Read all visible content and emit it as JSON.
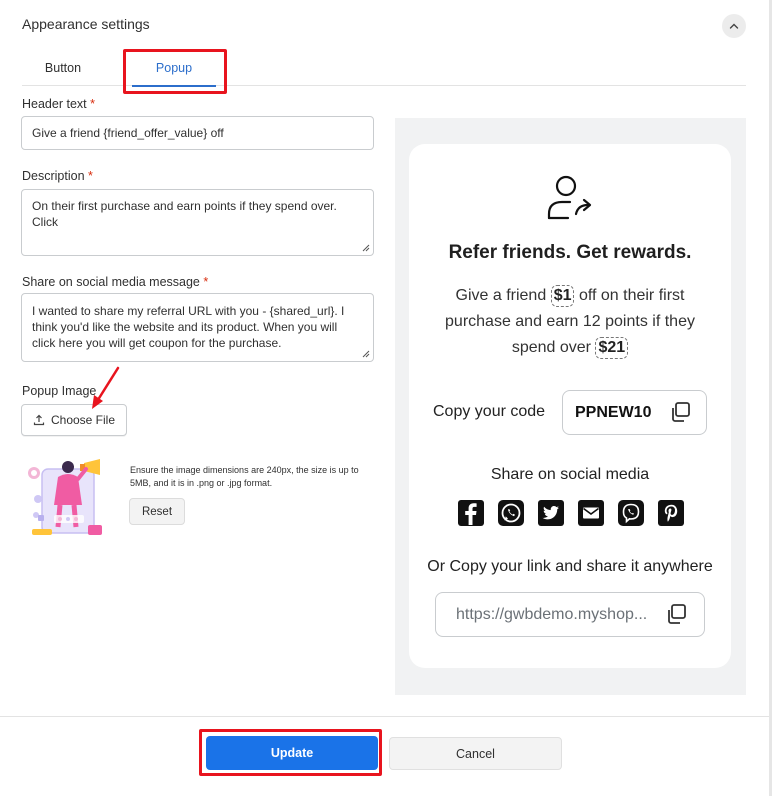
{
  "section": {
    "title": "Appearance settings"
  },
  "tabs": [
    {
      "label": "Button"
    },
    {
      "label": "Popup"
    }
  ],
  "fields": {
    "header_text": {
      "label": "Header text",
      "required": "*",
      "value": "Give a friend {friend_offer_value} off"
    },
    "description": {
      "label": "Description",
      "required": "*",
      "value": "On their first purchase and earn  points if they spend over.  Click"
    },
    "share_message": {
      "label": "Share on social media message",
      "required": "*",
      "value": "I wanted to share my referral URL with you - {shared_url}. I think you'd like the website and its product. When you will click here you will get coupon for the purchase."
    }
  },
  "popup_image": {
    "label": "Popup Image",
    "choose_label": "Choose File",
    "note": "Ensure the image dimensions are 240px, the size is up to 5MB, and it is in .png or .jpg format.",
    "reset_label": "Reset"
  },
  "preview": {
    "title": "Refer friends. Get rewards.",
    "desc_1": "Give a friend",
    "friend_value": "$1",
    "desc_2": "off on their first purchase and earn 12 points if they spend over",
    "min_spend": "$21",
    "copy_code_label": "Copy your code",
    "code": "PPNEW10",
    "share_title": "Share on social media",
    "socials": [
      "facebook-icon",
      "whatsapp-icon",
      "twitter-icon",
      "email-icon",
      "viber-icon",
      "pinterest-icon"
    ],
    "link_title": "Or Copy your link and share it anywhere",
    "link": "https://gwbdemo.myshop..."
  },
  "footer": {
    "update_label": "Update",
    "cancel_label": "Cancel"
  },
  "colors": {
    "accent": "#1a73e8",
    "tab_active": "#2c6ecb",
    "highlight": "#e8141e",
    "required": "#d72c0d"
  }
}
